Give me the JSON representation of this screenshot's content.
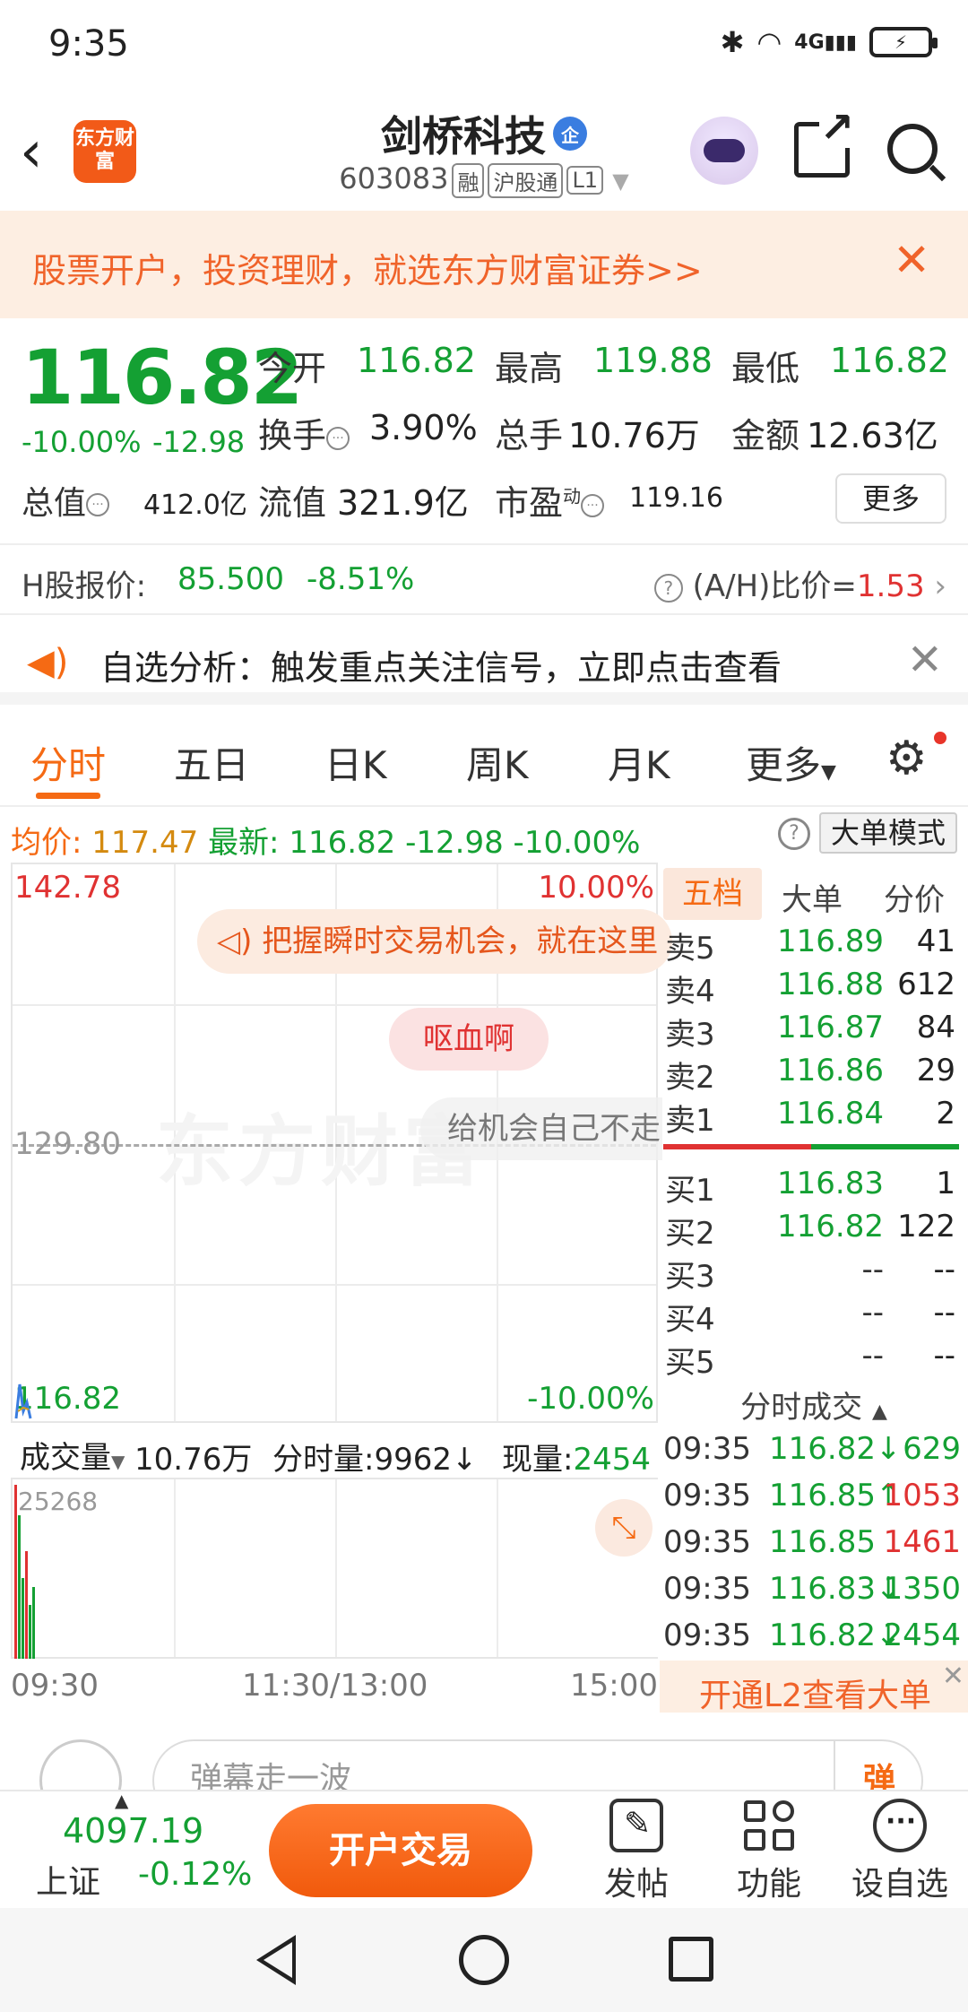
{
  "status_bar": {
    "time": "9:35",
    "network": "4G"
  },
  "header": {
    "app_logo_text": "东方财富",
    "stock_name": "剑桥科技",
    "stock_badge": "企",
    "stock_code": "603083",
    "tags": [
      "融",
      "沪股通",
      "L1"
    ]
  },
  "promo": {
    "text": "股票开户，投资理财，就选东方财富证券>>"
  },
  "quote": {
    "price": "116.82",
    "change_pct": "-10.00%",
    "change_amt": "-12.98",
    "open_label": "今开",
    "open": "116.82",
    "high_label": "最高",
    "high": "119.88",
    "low_label": "最低",
    "low": "116.82",
    "turnover_label": "换手",
    "turnover": "3.90%",
    "volume_label": "总手",
    "volume": "10.76万",
    "amount_label": "金额",
    "amount": "12.63亿",
    "mktcap_label": "总值",
    "mktcap": "412.0亿",
    "float_label": "流值",
    "float": "321.9亿",
    "pe_label": "市盈",
    "pe_sup": "动",
    "pe": "119.16",
    "more_label": "更多"
  },
  "h_share": {
    "label": "H股报价:",
    "price": "85.500",
    "pct": "-8.51%",
    "ratio_label": "(A/H)比价=",
    "ratio": "1.53"
  },
  "notice": {
    "text": "自选分析：触发重点关注信号，立即点击查看"
  },
  "tabs": [
    "分时",
    "五日",
    "日K",
    "周K",
    "月K",
    "更多"
  ],
  "avg_row": {
    "avg_label": "均价:",
    "avg": "117.47",
    "latest_label": "最新:",
    "latest": "116.82",
    "change": "-12.98",
    "pct": "-10.00%",
    "big_order_mode": "大单模式"
  },
  "chart": {
    "high": "142.78",
    "high_pct": "10.00%",
    "mid": "129.80",
    "low": "116.82",
    "low_pct": "-10.00%",
    "watermark": "东方财富",
    "ad_text": "把握瞬时交易机会，就在这里",
    "danmu_1": "呕血啊",
    "danmu_2": "给机会自己不走"
  },
  "volume_row": {
    "dropdown": "成交量",
    "total": "10.76万",
    "minute_label": "分时量:",
    "minute": "9962",
    "now_label": "现量:",
    "now": "2454",
    "max": "25268"
  },
  "time_axis": [
    "09:30",
    "11:30/13:00",
    "15:00"
  ],
  "order_book": {
    "tabs": [
      "五档",
      "大单",
      "分价"
    ],
    "sell": [
      {
        "label": "卖5",
        "price": "116.89",
        "qty": "41"
      },
      {
        "label": "卖4",
        "price": "116.88",
        "qty": "612"
      },
      {
        "label": "卖3",
        "price": "116.87",
        "qty": "84"
      },
      {
        "label": "卖2",
        "price": "116.86",
        "qty": "29"
      },
      {
        "label": "卖1",
        "price": "116.84",
        "qty": "2"
      }
    ],
    "buy": [
      {
        "label": "买1",
        "price": "116.83",
        "qty": "1"
      },
      {
        "label": "买2",
        "price": "116.82",
        "qty": "122"
      },
      {
        "label": "买3",
        "price": "--",
        "qty": "--"
      },
      {
        "label": "买4",
        "price": "--",
        "qty": "--"
      },
      {
        "label": "买5",
        "price": "--",
        "qty": "--"
      }
    ]
  },
  "trades": {
    "title": "分时成交",
    "rows": [
      {
        "time": "09:35",
        "price": "116.82↓",
        "vol": "629",
        "dir": "down"
      },
      {
        "time": "09:35",
        "price": "116.85↑",
        "vol": "1053",
        "dir": "up"
      },
      {
        "time": "09:35",
        "price": "116.85",
        "vol": "1461",
        "dir": "up"
      },
      {
        "time": "09:35",
        "price": "116.83↓",
        "vol": "1350",
        "dir": "down"
      },
      {
        "time": "09:35",
        "price": "116.82↓",
        "vol": "2454",
        "dir": "down"
      }
    ]
  },
  "l2_banner": {
    "text": "开通L2查看大单"
  },
  "danmu_bar": {
    "placeholder": "弹幕走一波",
    "send": "弹"
  },
  "bottom_bar": {
    "index_value": "4097.19",
    "index_name": "上证",
    "index_pct": "-0.12%",
    "open_trade": "开户交易",
    "items": [
      "发帖",
      "功能",
      "设自选"
    ]
  },
  "colors": {
    "accent": "#f56a14",
    "down": "#14a033",
    "up": "#e03232"
  }
}
